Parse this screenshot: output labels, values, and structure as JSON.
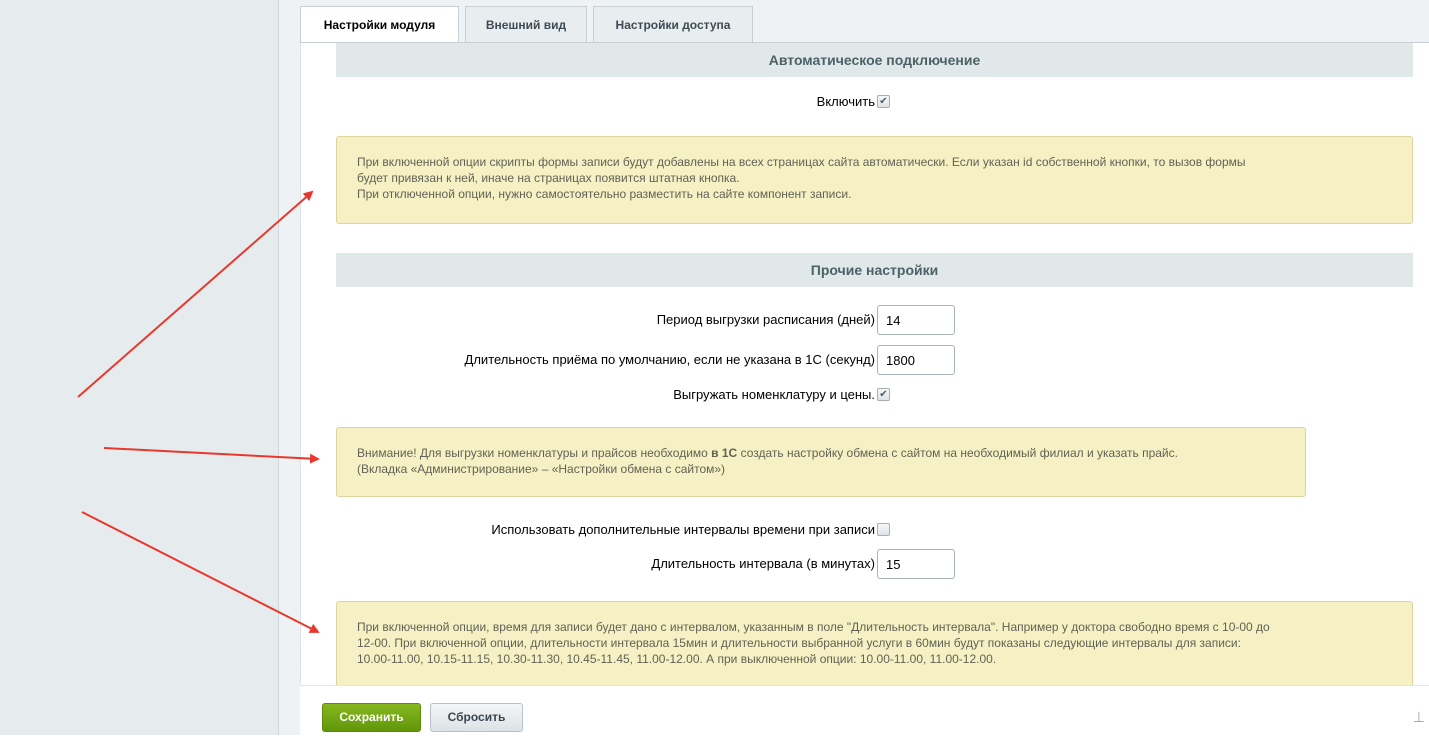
{
  "tabs": [
    {
      "label": "Настройки модуля",
      "active": true
    },
    {
      "label": "Внешний вид",
      "active": false
    },
    {
      "label": "Настройки доступа",
      "active": false
    }
  ],
  "sections": {
    "auto": {
      "title": "Автоматическое подключение",
      "enable_label": "Включить",
      "enable_checked": true,
      "note_lines": [
        "При включенной опции скрипты формы записи будут добавлены на всех страницах сайта автоматически. Если указан id собственной кнопки, то вызов формы",
        "будет привязан к ней, иначе на страницах появится штатная кнопка.",
        "При отключенной опции, нужно самостоятельно разместить на сайте компонент записи."
      ]
    },
    "other": {
      "title": "Прочие настройки",
      "period_label": "Период выгрузки расписания (дней)",
      "period_value": "14",
      "duration_label": "Длительность приёма по умолчанию, если не указана в 1С (секунд)",
      "duration_value": "1800",
      "export_label": "Выгружать номенклатуру и цены.",
      "export_checked": true,
      "warning": {
        "line1_before": "Внимание! Для выгрузки номенклатуры и прайсов необходимо ",
        "line1_bold": "в 1С",
        "line1_after": " создать настройку обмена с сайтом на необходимый филиал и указать прайс.",
        "line2": "(Вкладка «Администрирование» – «Настройки обмена с сайтом»)"
      },
      "intervals_label": "Использовать дополнительные интервалы времени при записи",
      "intervals_checked": false,
      "interval_len_label": "Длительность интервала (в минутах)",
      "interval_len_value": "15",
      "interval_note_lines": [
        "При включенной опции, время для записи будет дано с интервалом, указанным в поле \"Длительность интервала\". Например у доктора свободно время с 10-00 до",
        "12-00. При включенной опции, длительности интервала 15мин и длительности выбранной услуги в 60мин будут показаны следующие интервалы для записи:",
        "10.00-11.00, 10.15-11.15, 10.30-11.30, 10.45-11.45, 11.00-12.00. А при выключенной опции: 10.00-11.00, 11.00-12.00."
      ]
    }
  },
  "footer": {
    "save_label": "Сохранить",
    "reset_label": "Сбросить"
  },
  "icons": {
    "check": "✔",
    "pin": "⊥"
  },
  "colors": {
    "save_button": "#6fa313",
    "note_background": "#f5f1c5",
    "section_header": "#e0e8ea",
    "arrow": "#e8382d"
  }
}
